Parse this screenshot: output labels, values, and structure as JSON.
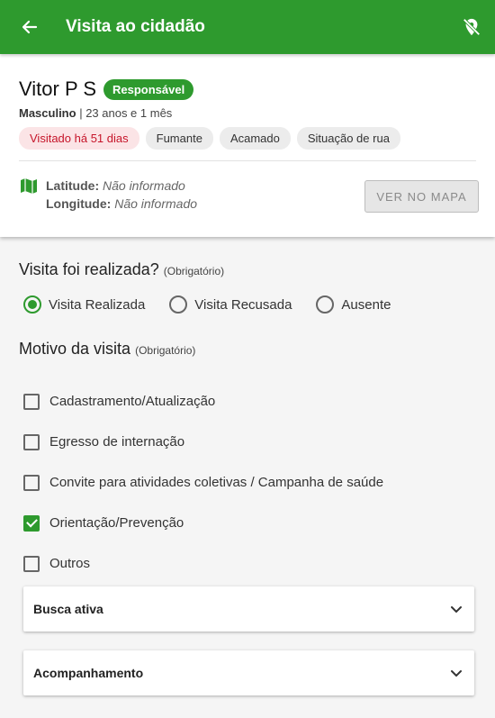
{
  "appbar": {
    "title": "Visita ao cidadão",
    "back_icon": "arrow-back-icon",
    "location_off_icon": "location-off-icon"
  },
  "citizen": {
    "name": "Vitor P S",
    "role_badge": "Responsável",
    "sex": "Masculino",
    "age": "23 anos e 1 mês",
    "tags": [
      "Visitado há 51 dias",
      "Fumante",
      "Acamado",
      "Situação de rua"
    ],
    "latitude_label": "Latitude:",
    "latitude_value": "Não informado",
    "longitude_label": "Longitude:",
    "longitude_value": "Não informado",
    "map_button": "VER NO MAPA"
  },
  "visit_question": {
    "title": "Visita foi realizada?",
    "required": "(Obrigatório)",
    "options": [
      {
        "label": "Visita Realizada",
        "checked": true
      },
      {
        "label": "Visita Recusada",
        "checked": false
      },
      {
        "label": "Ausente",
        "checked": false
      }
    ]
  },
  "reason_question": {
    "title": "Motivo da visita",
    "required": "(Obrigatório)",
    "options": [
      {
        "label": "Cadastramento/Atualização",
        "checked": false
      },
      {
        "label": "Egresso de internação",
        "checked": false
      },
      {
        "label": "Convite para atividades coletivas / Campanha de saúde",
        "checked": false
      },
      {
        "label": "Orientação/Prevenção",
        "checked": true
      },
      {
        "label": "Outros",
        "checked": false
      }
    ]
  },
  "accordions": [
    {
      "label": "Busca ativa"
    },
    {
      "label": "Acompanhamento"
    }
  ],
  "colors": {
    "primary": "#2e9a2e",
    "alert_text": "#c6152a",
    "alert_bg": "#fbe4e6"
  }
}
